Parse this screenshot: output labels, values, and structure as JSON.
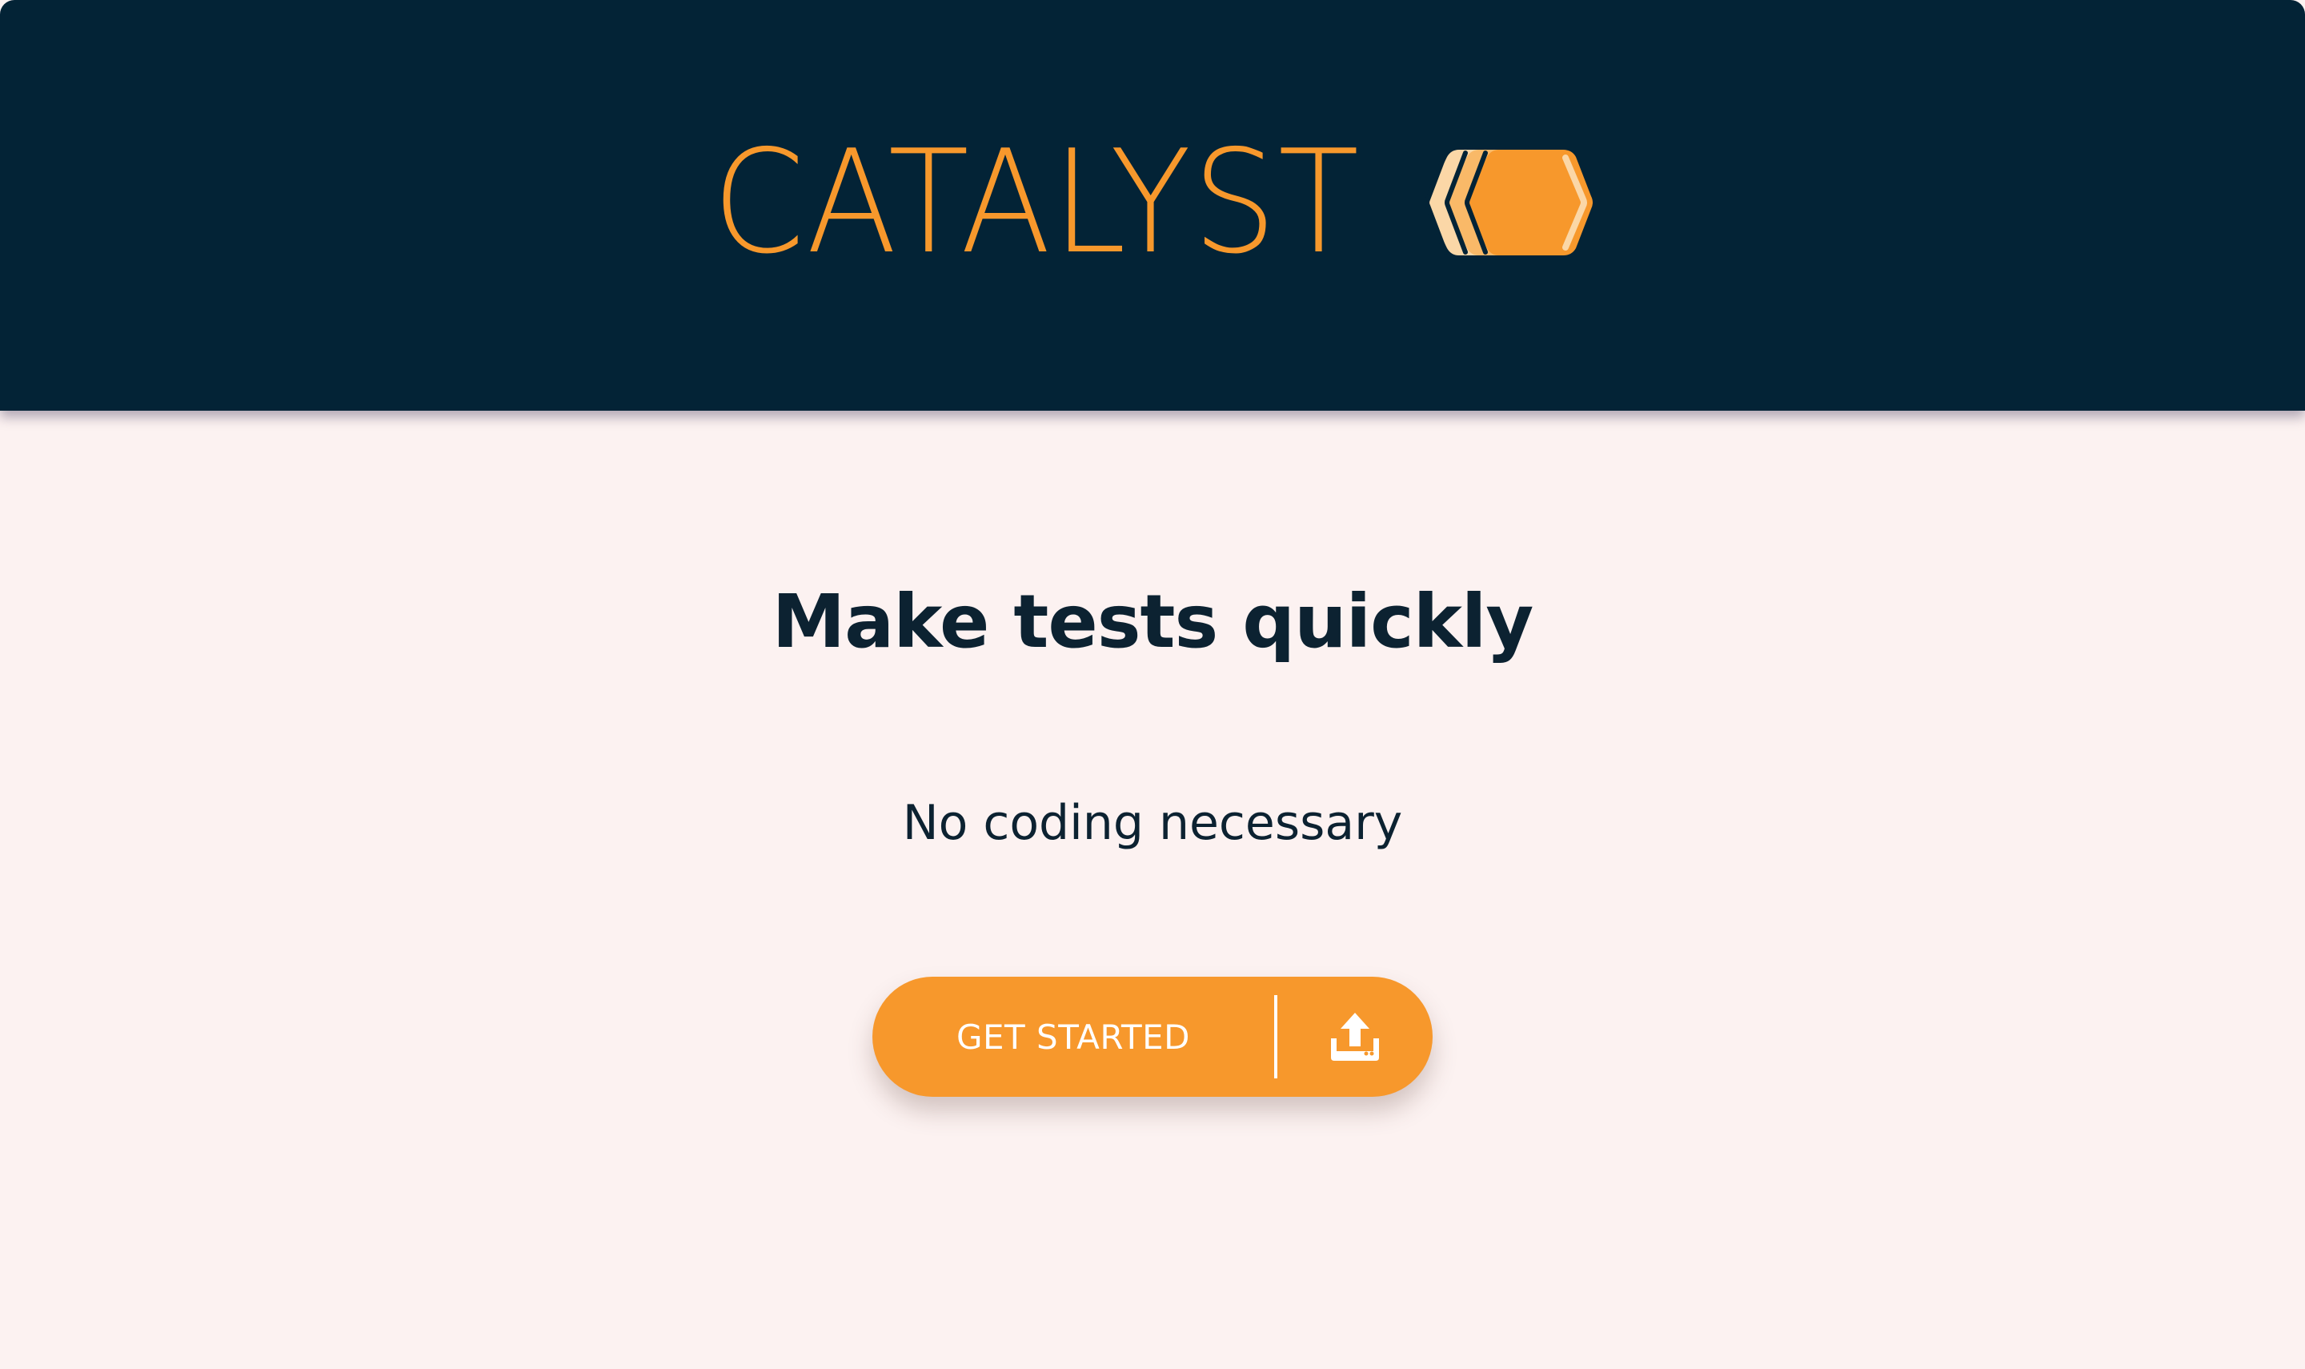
{
  "header": {
    "brand_name": "CATALYST",
    "logo_icon": "hexagon-chevron-logo-icon",
    "background_color": "#032336",
    "brand_color": "#f7982c"
  },
  "main": {
    "headline": "Make tests quickly",
    "subheadline": "No coding necessary",
    "cta": {
      "label": "GET STARTED",
      "icon": "upload-icon",
      "color": "#f7982c"
    },
    "background_color": "#fcf2f1",
    "text_color": "#0c2231"
  }
}
